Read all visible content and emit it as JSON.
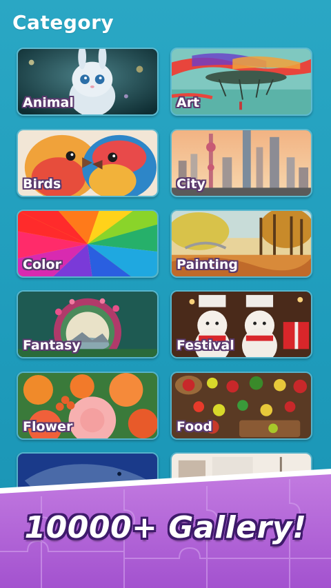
{
  "header": {
    "title": "Category"
  },
  "categories": [
    {
      "label": "Animal"
    },
    {
      "label": "Art"
    },
    {
      "label": "Birds"
    },
    {
      "label": "City"
    },
    {
      "label": "Color"
    },
    {
      "label": "Painting"
    },
    {
      "label": "Fantasy"
    },
    {
      "label": "Festival"
    },
    {
      "label": "Flower"
    },
    {
      "label": "Food"
    },
    {
      "label": ""
    },
    {
      "label": ""
    }
  ],
  "banner": {
    "text": "10000+ Gallery!"
  },
  "colors": {
    "background": "#2aa7c4",
    "banner": "#b264d8",
    "label_outline": "#5b3a6e"
  }
}
